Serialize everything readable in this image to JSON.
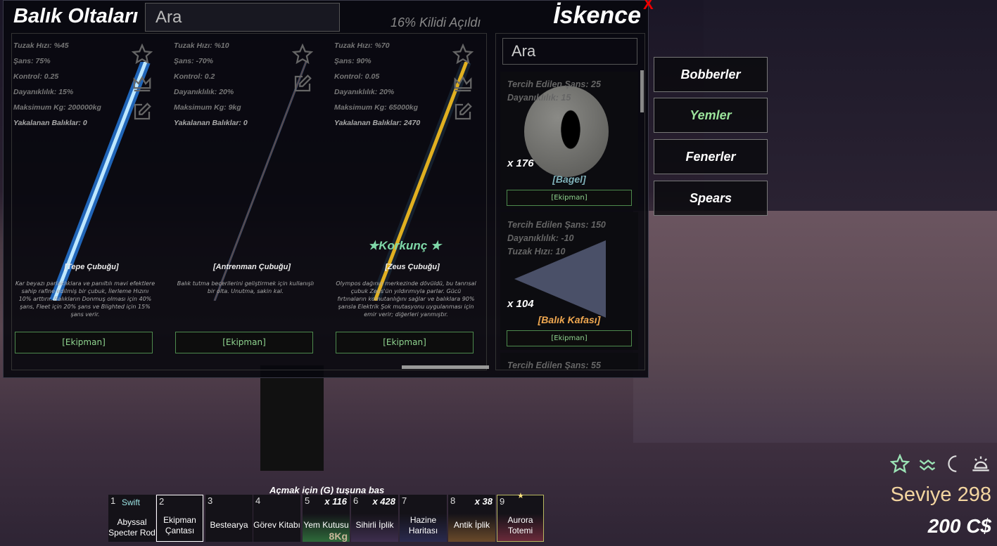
{
  "header": {
    "title": "Balık Oltaları",
    "search_placeholder": "Ara",
    "unlock_text": "16% Kilidi Açıldı",
    "active_tab": "İskence",
    "close_label": "X"
  },
  "rods": [
    {
      "stats": [
        "Tuzak Hızı: %45",
        "Şans: 75%",
        "Kontrol: 0.25",
        "Dayanıklılık: 15%",
        "Maksimum Kg: 200000kg",
        "Yakalanan Balıklar: 0"
      ],
      "name": "[Tepe Çubuğu]",
      "description": "Kar beyazı parlaklıklara ve panıltılı mavi efektlere sahip rafine edilmiş bir çubuk, İlerleme Hızını 10% arttırır. Balıkların Donmuş olması için 40% şans, Fleet için 20% şans ve Blighted için 15% şans verir.",
      "equip": "[Ekipman]",
      "has_crown": true
    },
    {
      "stats": [
        "Tuzak Hızı: %10",
        "Şans: -70%",
        "Kontrol: 0.2",
        "Dayanıklılık: 20%",
        "Maksimum Kg: 9kg",
        "Yakalanan Balıklar: 0"
      ],
      "name": "[Antrenman Çubuğu]",
      "description": "Balık tutma becerilerini geliştirmek için kullanışlı bir olta. Unutma, sakin kal.",
      "equip": "[Ekipman]",
      "has_crown": false
    },
    {
      "stats": [
        "Tuzak Hızı: %70",
        "Şans: 90%",
        "Kontrol: 0.05",
        "Dayanıklılık: 20%",
        "Maksimum Kg: 65000kg",
        "Yakalanan Balıklar: 2470"
      ],
      "name": "[Zeus Çubuğu]",
      "mutation": "★Korkunç ★",
      "description": "Olympos dağının merkezinde dövüldü, bu tanrısal çubuk Zeus'ün yıldırımıyla parlar. Gücü fırtınaların komutanlığını sağlar ve balıklara 90% şansla Elektrik Şok mutasyonu uygulanması için emir verir; diğerleri yanmıştır.",
      "equip": "[Ekipman]",
      "has_crown": true
    }
  ],
  "baits": {
    "search_placeholder": "Ara",
    "items": [
      {
        "stats": [
          "Tercih Edilen Şans: 25",
          "Dayanıklılık: 15"
        ],
        "count": "x 176",
        "name": "[Bagel]",
        "name_color": "#7fb0b8",
        "equip": "[Ekipman]"
      },
      {
        "stats": [
          "Tercih Edilen Şans: 150",
          "Dayanıklılık: -10",
          "Tuzak Hızı: 10"
        ],
        "count": "x 104",
        "name": "[Balık Kafası]",
        "name_color": "#f0a850",
        "equip": "[Ekipman]"
      },
      {
        "stats": [
          "Tercih Edilen Şans: 55"
        ]
      }
    ]
  },
  "categories": [
    {
      "label": "Bobberler",
      "color": "#ffffff"
    },
    {
      "label": "Yemler",
      "color": "#9be39b"
    },
    {
      "label": "Fenerler",
      "color": "#ffffff"
    },
    {
      "label": "Spears",
      "color": "#ffffff"
    }
  ],
  "hotbar": {
    "hint": "Açmak için (G) tuşuna bas",
    "slots": [
      {
        "n": "1",
        "tag": "Swift",
        "label": "Abyssal Specter Rod",
        "bg": "#141218"
      },
      {
        "n": "2",
        "label": "Ekipman Çantası",
        "bg": "#141218",
        "selected": true
      },
      {
        "n": "3",
        "label": "Bestearya",
        "bg": "#141218"
      },
      {
        "n": "4",
        "label": "Görev Kitabı",
        "bg": "#141218"
      },
      {
        "n": "5",
        "qty": "x 116",
        "label": "Yem Kutusu",
        "weight": "8Kg",
        "bg": "#2e6a3a"
      },
      {
        "n": "6",
        "qty": "x 428",
        "label": "Sihirli İplik",
        "bg": "#3e2e4e"
      },
      {
        "n": "7",
        "label": "Hazine Haritası",
        "bg": "#2a2a4e"
      },
      {
        "n": "8",
        "qty": "x 38",
        "label": "Antik İplik",
        "bg": "#6a4a2a"
      },
      {
        "n": "9",
        "label": "Aurora Totemi",
        "bg": "#6a2a3a",
        "favorite": true
      }
    ]
  },
  "hud": {
    "level": "Seviye 298",
    "currency": "200 C$",
    "accent": "#9be3b5"
  }
}
